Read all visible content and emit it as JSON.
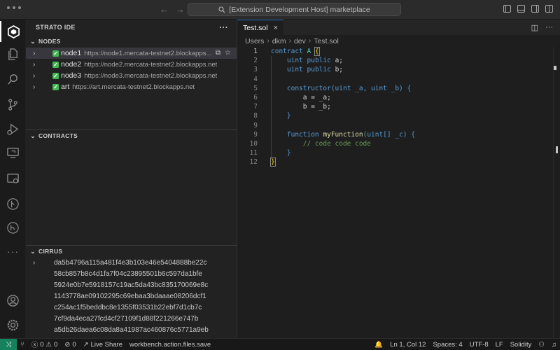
{
  "titlebar": {
    "search_text": "[Extension Development Host] marketplace"
  },
  "activity_bar": {
    "items": [
      "strato-icon",
      "explorer-icon",
      "search-icon",
      "source-control-icon",
      "run-debug-icon",
      "remote-explorer-icon",
      "extensions-icon",
      "git-graph-icon",
      "github-icon",
      "more-icon"
    ],
    "bottom": [
      "accounts-icon",
      "manage-icon"
    ]
  },
  "sidebar": {
    "title": "STRATO IDE",
    "more": "···",
    "nodes_header": "NODES",
    "nodes": [
      {
        "name": "node1",
        "url": "https://node1.mercata-testnet2.blockapps..."
      },
      {
        "name": "node2",
        "url": "https://node2.mercata-testnet2.blockapps.net"
      },
      {
        "name": "node3",
        "url": "https://node3.mercata-testnet2.blockapps.net"
      },
      {
        "name": "art",
        "url": "https://art.mercata-testnet2.blockapps.net"
      }
    ],
    "contracts_header": "CONTRACTS",
    "cirrus_header": "CIRRUS",
    "cirrus": [
      "da5b4796a115a481f4e3b103e46e5404888be22c",
      "58cb857b8c4d1fa7f04c23895501b6c597da1bfe",
      "5924e0b7e5918157c19ac5da43bc835170069e8c",
      "1143778ae09102295c69ebaa3bdaaae08206dcf1",
      "c254ac1f5beddbc8e1355f03531b22ebf7d1cb7c",
      "7cf9da4eca27fcd4cf27109f1d88f221266e747b",
      "a5db26daea6c08da8a41987ac460876c5771a9eb"
    ]
  },
  "editor": {
    "tab_label": "Test.sol",
    "breadcrumb": [
      "Users",
      "dkm",
      "dev",
      "Test.sol"
    ],
    "line_numbers": [
      "1",
      "2",
      "3",
      "4",
      "5",
      "6",
      "7",
      "8",
      "9",
      "10",
      "11",
      "12"
    ],
    "code": {
      "l1_kw": "contract",
      "l1_name": "A",
      "l1_brace": "{",
      "l2_type": "uint",
      "l2_kw": "public",
      "l2_var": "a;",
      "l3_type": "uint",
      "l3_kw": "public",
      "l3_var": "b;",
      "l5_kw": "constructor",
      "l5_args": "(uint _a, uint _b) {",
      "l6": "a = _a;",
      "l7": "b = _b;",
      "l8": "}",
      "l10_kw": "function",
      "l10_name": "myFunction",
      "l10_args": "(uint[] _c) {",
      "l11": "// code code code",
      "l12": "}",
      "l13": "}"
    }
  },
  "statusbar": {
    "errors": "0",
    "warnings": "0",
    "ports": "0",
    "live_share": "Live Share",
    "command": "workbench.action.files.save",
    "position": "Ln 1, Col 12",
    "spaces": "Spaces: 4",
    "encoding": "UTF-8",
    "eol": "LF",
    "language": "Solidity"
  },
  "colors": {
    "accent": "#2a7bd4",
    "remote": "#16825d",
    "check": "#3fb950"
  }
}
